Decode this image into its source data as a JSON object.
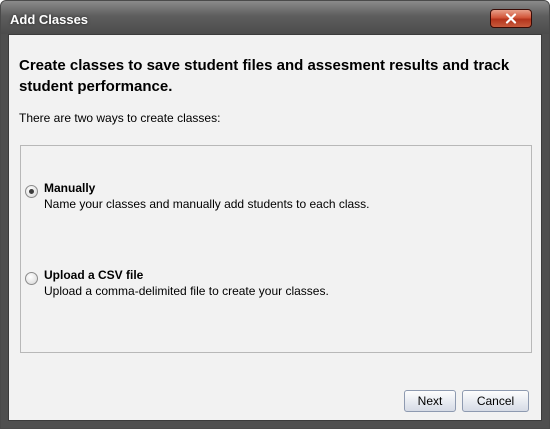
{
  "window": {
    "title": "Add Classes",
    "close_icon": "close-x-icon"
  },
  "content": {
    "heading": "Create classes to save student files and assesment results and track student performance.",
    "intro": "There are two ways to create classes:"
  },
  "options": [
    {
      "title": "Manually",
      "description": "Name your classes and manually add students to each class.",
      "selected": true
    },
    {
      "title": "Upload a CSV file",
      "description": "Upload a comma-delimited file to create your classes.",
      "selected": false
    }
  ],
  "buttons": {
    "next": "Next",
    "cancel": "Cancel"
  },
  "colors": {
    "titlebar": "#5e5e5e",
    "close_button": "#c8472c",
    "dialog_background": "#f2f2f2"
  }
}
